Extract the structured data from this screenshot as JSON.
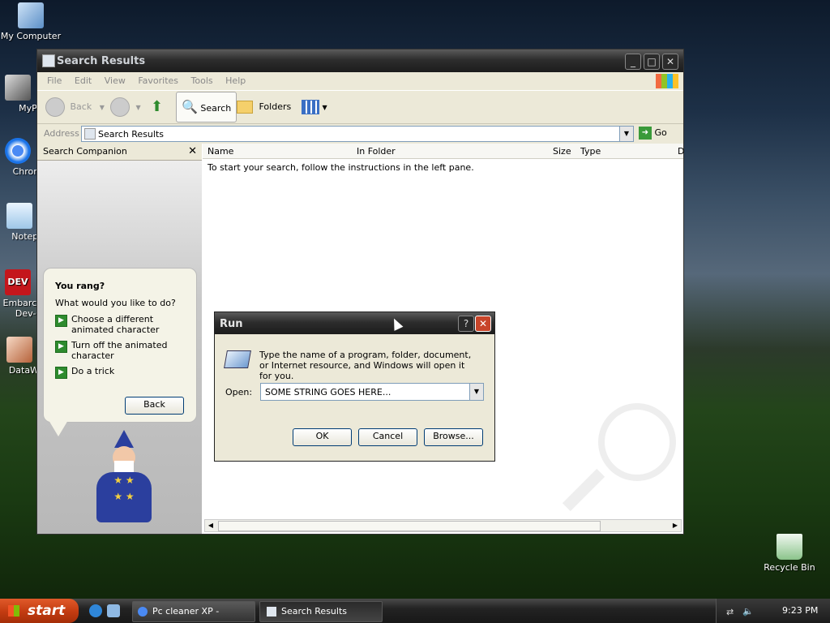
{
  "desktop": {
    "icons": [
      {
        "label": "My Computer"
      },
      {
        "label": "MyPa"
      },
      {
        "label": "Chrom"
      },
      {
        "label": "Notepa"
      },
      {
        "label": "Embarca\nDev-C"
      },
      {
        "label": "DataWa"
      },
      {
        "label": "Recycle Bin"
      }
    ]
  },
  "explorer": {
    "title": "Search Results",
    "menu": [
      "File",
      "Edit",
      "View",
      "Favorites",
      "Tools",
      "Help"
    ],
    "toolbar": {
      "back": "Back",
      "search": "Search",
      "folders": "Folders"
    },
    "address_label": "Address",
    "address_value": "Search Results",
    "go": "Go",
    "companion_title": "Search Companion",
    "columns": [
      "Name",
      "In Folder",
      "Size",
      "Type",
      "D"
    ],
    "empty_message": "To start your search, follow the instructions in the left pane."
  },
  "balloon": {
    "title": "You rang?",
    "question": "What would you like to do?",
    "options": [
      "Choose a different animated character",
      "Turn off the animated character",
      "Do a trick"
    ],
    "back": "Back"
  },
  "run": {
    "title": "Run",
    "help": "?",
    "description": "Type the name of a program, folder, document, or Internet resource, and Windows will open it for you.",
    "open_label": "Open:",
    "open_value": "SOME STRING GOES HERE...",
    "ok": "OK",
    "cancel": "Cancel",
    "browse": "Browse..."
  },
  "taskbar": {
    "start": "start",
    "tasks": [
      "Pc cleaner XP - Googl...",
      "Search Results"
    ],
    "clock": "9:23 PM"
  }
}
